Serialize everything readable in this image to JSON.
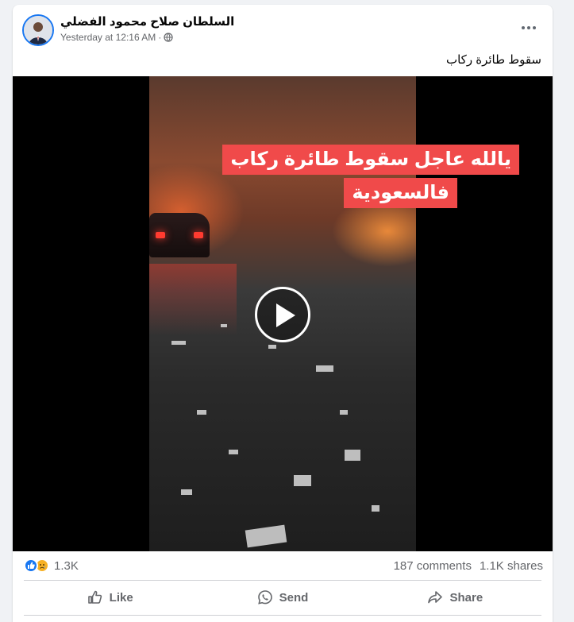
{
  "post": {
    "author": "السلطان صلاح محمود الفضلي",
    "timestamp": "Yesterday at 12:16 AM",
    "separator": "·",
    "privacy_icon": "globe-icon",
    "caption": "سقوط طائرة ركاب"
  },
  "video": {
    "overlay_line1": "يالله عاجل سقوط طائرة ركاب",
    "overlay_line2": "فالسعودية",
    "play_icon": "play-icon"
  },
  "stats": {
    "reaction_count": "1.3K",
    "comments": "187 comments",
    "shares": "1.1K shares"
  },
  "actions": {
    "like_label": "Like",
    "send_label": "Send",
    "share_label": "Share"
  },
  "colors": {
    "accent": "#1877f2",
    "overlay_bg": "#f04a4a",
    "text_secondary": "#65676b"
  }
}
